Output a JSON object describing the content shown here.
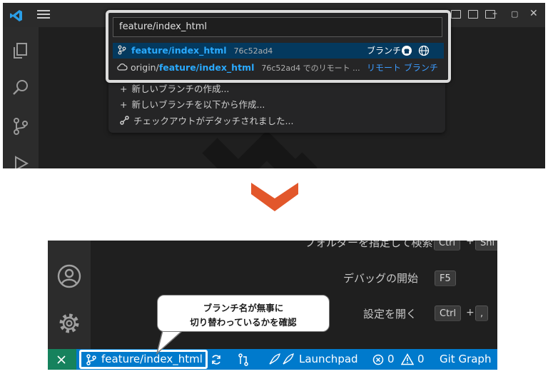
{
  "top_screen": {
    "search_value": "feature/index_html",
    "selected_item": {
      "name": "feature/index_html",
      "hash": "76c52ad4",
      "type_label": "ブランチ"
    },
    "remote_item": {
      "prefix": "origin/",
      "name": "feature/index_html",
      "detail": "76c52ad4 でのリモート ...",
      "type_label": "リモート ブランチ"
    },
    "actions": [
      "新しいブランチの作成...",
      "新しいブランチを以下から作成...",
      "チェックアウトがデタッチされました..."
    ]
  },
  "bottom_screen": {
    "shortcuts": [
      {
        "label": "フォルダーを指定して検索",
        "keys": [
          "Ctrl",
          "Shi"
        ]
      },
      {
        "label": "デバッグの開始",
        "keys": [
          "F5"
        ]
      },
      {
        "label": "設定を開く",
        "keys": [
          "Ctrl",
          ","
        ]
      }
    ],
    "statusbar": {
      "branch": "feature/index_html",
      "launchpad": "Launchpad",
      "errors": "0",
      "warnings": "0",
      "git_graph": "Git Graph"
    },
    "callout": {
      "line1": "ブランチ名が無事に",
      "line2": "切り替わっているかを確認"
    }
  },
  "colors": {
    "accent_blue": "#2aaaff",
    "statusbar": "#007acc",
    "remote_green": "#16825d",
    "arrow": "#e2572b"
  }
}
